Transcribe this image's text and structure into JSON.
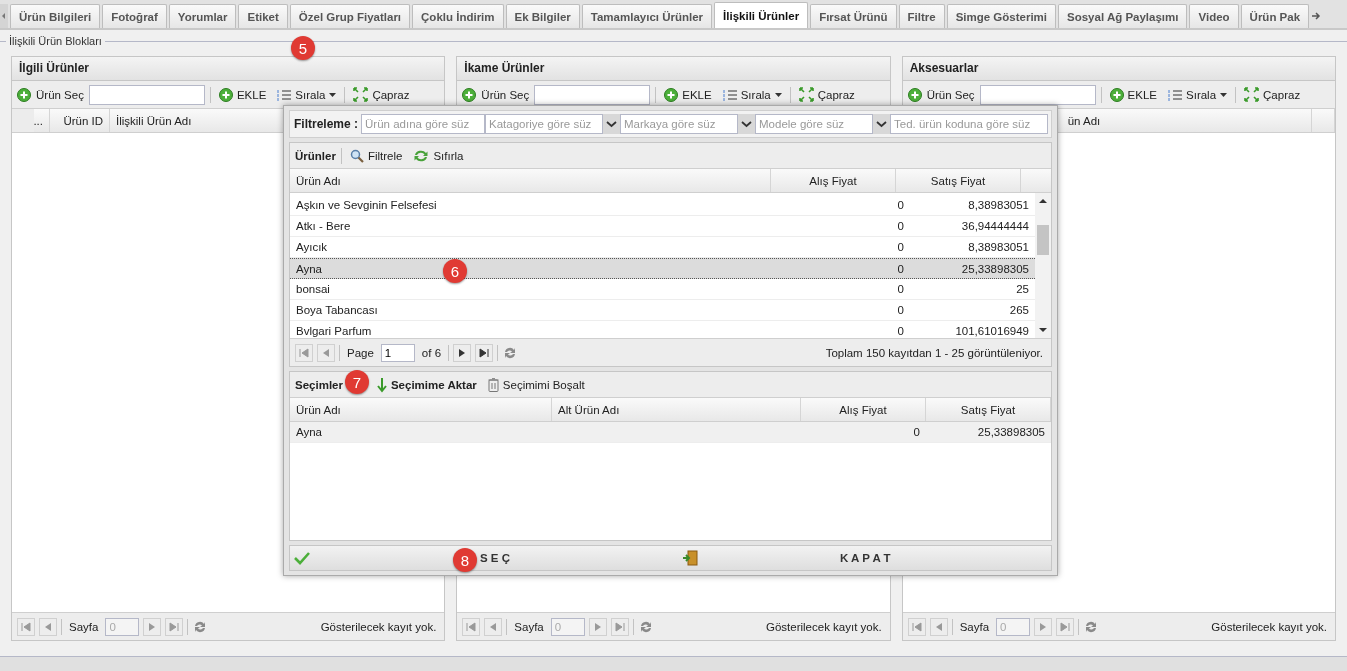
{
  "tabs": [
    {
      "label": "Ürün Bilgileri",
      "selected": false
    },
    {
      "label": "Fotoğraf",
      "selected": false
    },
    {
      "label": "Yorumlar",
      "selected": false
    },
    {
      "label": "Etiket",
      "selected": false
    },
    {
      "label": "Özel Grup Fiyatları",
      "selected": false
    },
    {
      "label": "Çoklu İndirim",
      "selected": false
    },
    {
      "label": "Ek Bilgiler",
      "selected": false
    },
    {
      "label": "Tamamlayıcı Ürünler",
      "selected": false
    },
    {
      "label": "İlişkili Ürünler",
      "selected": true
    },
    {
      "label": "Fırsat Ürünü",
      "selected": false
    },
    {
      "label": "Filtre",
      "selected": false
    },
    {
      "label": "Simge Gösterimi",
      "selected": false
    },
    {
      "label": "Sosyal Ağ Paylaşımı",
      "selected": false
    },
    {
      "label": "Video",
      "selected": false
    },
    {
      "label": "Ürün Pak",
      "selected": false
    }
  ],
  "fieldset": {
    "legend": "İlişkili Ürün Blokları"
  },
  "panels": [
    {
      "title": "İlgili Ürünler",
      "pick_label": "Ürün Seç",
      "add_label": "EKLE",
      "sort_label": "Sırala",
      "cross_label": "Çapraz",
      "columns": [
        {
          "kind": "ellipsis",
          "label": "..."
        },
        {
          "kind": "id",
          "label": "Ürün ID"
        },
        {
          "kind": "name",
          "label": "İlişkili Ürün Adı"
        }
      ],
      "page_label": "Sayfa",
      "page_value": "0",
      "empty_text": "Gösterilecek kayıt yok."
    },
    {
      "title": "İkame Ürünler",
      "pick_label": "Ürün Seç",
      "add_label": "EKLE",
      "sort_label": "Sırala",
      "cross_label": "Çapraz",
      "page_label": "Sayfa",
      "page_value": "0",
      "empty_text": "Gösterilecek kayıt yok."
    },
    {
      "title": "Aksesuarlar",
      "pick_label": "Ürün Seç",
      "add_label": "EKLE",
      "sort_label": "Sırala",
      "cross_label": "Çapraz",
      "columns": [
        {
          "kind": "covered"
        },
        {
          "kind": "name",
          "label": "ün Adı"
        }
      ],
      "page_label": "Sayfa",
      "page_value": "0",
      "empty_text": "Gösterilecek kayıt yok."
    }
  ],
  "dialog": {
    "filter_label": "Filtreleme :",
    "filters": [
      {
        "kind": "text",
        "placeholder": "Ürün adına göre süz"
      },
      {
        "kind": "combo",
        "placeholder": "Katagoriye göre süz"
      },
      {
        "kind": "combo",
        "placeholder": "Markaya göre süz"
      },
      {
        "kind": "combo",
        "placeholder": "Modele göre süz"
      },
      {
        "kind": "text",
        "placeholder": "Ted. ürün koduna göre süz"
      }
    ],
    "products": {
      "title": "Ürünler",
      "filter_button": "Filtrele",
      "reset_button": "Sıfırla",
      "columns": [
        "Ürün Adı",
        "Alış Fiyat",
        "Satış Fiyat"
      ],
      "rows": [
        {
          "name": "Aşkın ve Sevginin Felsefesi",
          "buy": "0",
          "sell": "8,38983051",
          "selected": false
        },
        {
          "name": "Atkı - Bere",
          "buy": "0",
          "sell": "36,94444444",
          "selected": false
        },
        {
          "name": "Ayıcık",
          "buy": "0",
          "sell": "8,38983051",
          "selected": false
        },
        {
          "name": "Ayna",
          "buy": "0",
          "sell": "25,33898305",
          "selected": true
        },
        {
          "name": "bonsai",
          "buy": "0",
          "sell": "25",
          "selected": false
        },
        {
          "name": "Boya Tabancası",
          "buy": "0",
          "sell": "265",
          "selected": false
        },
        {
          "name": "Bvlgari Parfum",
          "buy": "0",
          "sell": "101,61016949",
          "selected": false
        }
      ],
      "page_label": "Page",
      "page_value": "1",
      "page_of": "of 6",
      "summary": "Toplam 150 kayıtdan 1 - 25 görüntüleniyor."
    },
    "selections": {
      "title": "Seçimler",
      "move_button": "Seçimime Aktar",
      "clear_button": "Seçimimi Boşalt",
      "columns": [
        "Ürün Adı",
        "Alt Ürün Adı",
        "Alış Fiyat",
        "Satış Fiyat"
      ],
      "rows": [
        {
          "name": "Ayna",
          "buy": "0",
          "sell": "25,33898305"
        }
      ]
    },
    "select_button": "S E Ç",
    "close_button": "K A P A T"
  },
  "annotations": [
    "5",
    "6",
    "7",
    "8"
  ]
}
